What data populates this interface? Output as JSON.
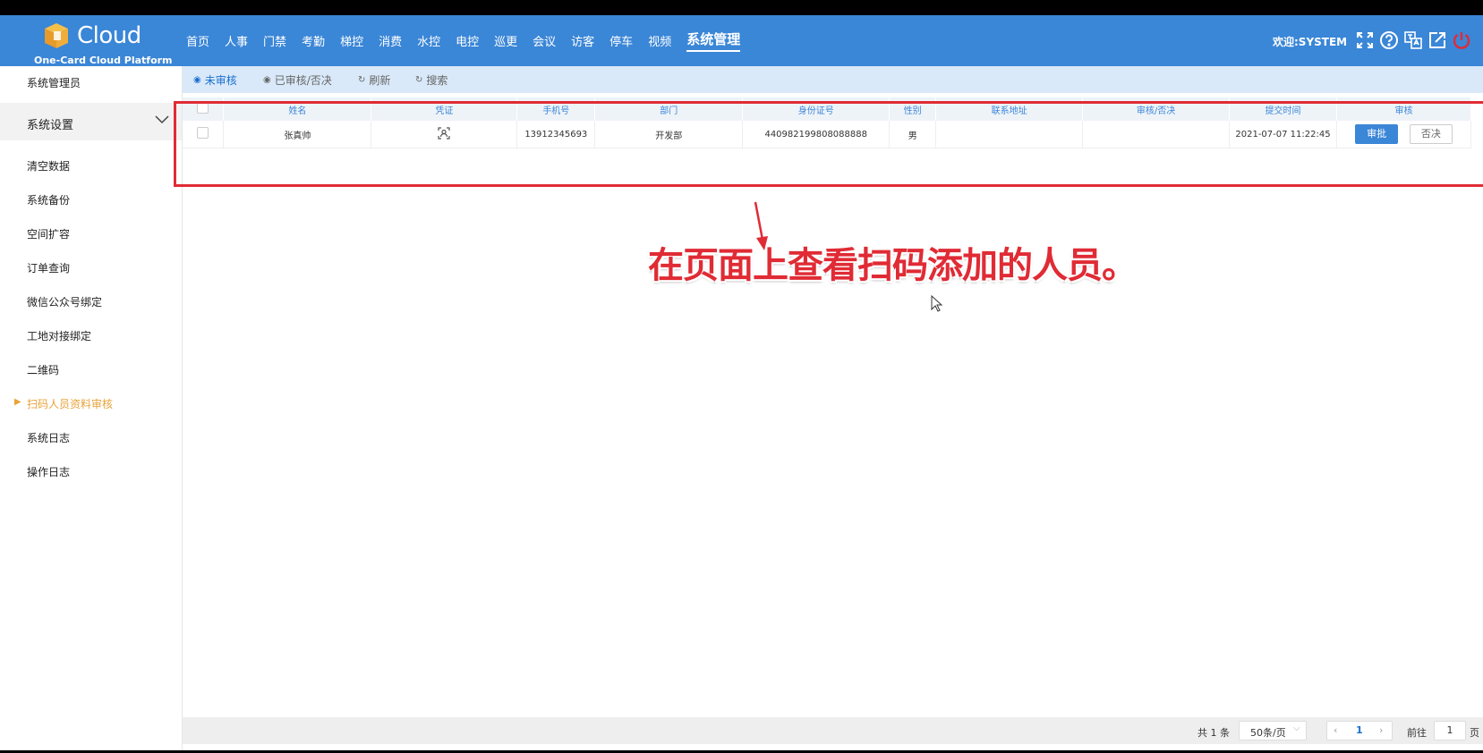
{
  "header": {
    "logo_text": "Cloud",
    "logo_sub": "One-Card Cloud Platform",
    "nav": [
      "首页",
      "人事",
      "门禁",
      "考勤",
      "梯控",
      "消费",
      "水控",
      "电控",
      "巡更",
      "会议",
      "访客",
      "停车",
      "视频",
      "系统管理"
    ],
    "welcome": "欢迎:SYSTEM",
    "icons": [
      "fullscreen-icon",
      "help-icon",
      "language-icon",
      "export-icon",
      "power-icon"
    ]
  },
  "sidebar": {
    "top_item": "系统管理员",
    "group_label": "系统设置",
    "items": [
      "清空数据",
      "系统备份",
      "空间扩容",
      "订单查询",
      "微信公众号绑定",
      "工地对接绑定",
      "二维码",
      "扫码人员资料审核",
      "系统日志",
      "操作日志"
    ],
    "active_item": "扫码人员资料审核"
  },
  "toolbar": {
    "pending": "未审核",
    "reviewed": "已审核/否决",
    "refresh": "刷新",
    "search": "搜索"
  },
  "table": {
    "headers": [
      "姓名",
      "凭证",
      "手机号",
      "部门",
      "身份证号",
      "性别",
      "联系地址",
      "审核/否决",
      "提交时间",
      "审核"
    ],
    "rows": [
      {
        "name": "张真帅",
        "phone": "13912345693",
        "dept": "开发部",
        "id_number": "440982199808088888",
        "gender": "男",
        "address": "",
        "review_status": "",
        "submit_time": "2021-07-07 11:22:45",
        "approve_label": "审批",
        "reject_label": "否决"
      }
    ]
  },
  "annotation": {
    "text": "在页面上查看扫码添加的人员。",
    "color": "#e02b35"
  },
  "footer": {
    "total": "共 1 条",
    "page_size": "50条/页",
    "current_page": "1",
    "goto_label": "前往",
    "goto_value": "1",
    "page_unit": "页"
  },
  "colors": {
    "header_bg": "#3a86d7",
    "accent": "#e8a33a",
    "annotation": "#e02b35"
  }
}
